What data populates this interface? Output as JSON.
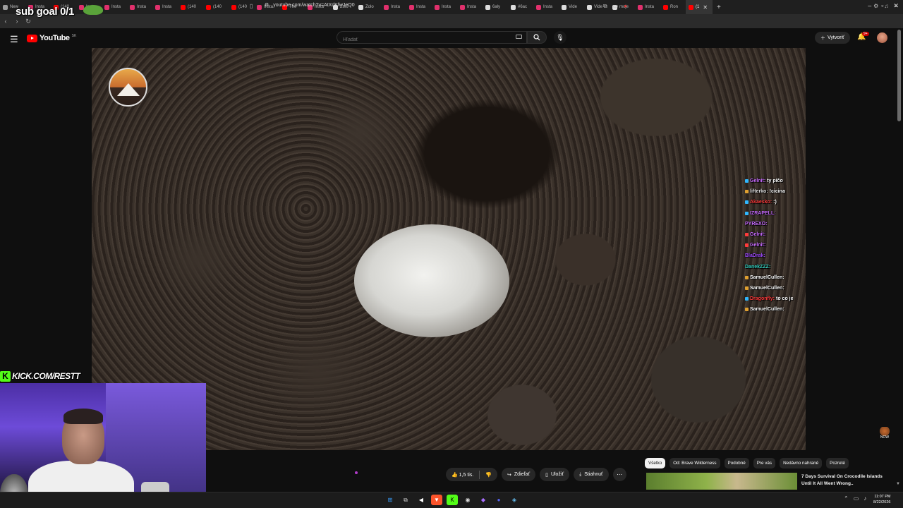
{
  "overlay": {
    "sub_goal": "sub goal 0/1",
    "kick_url": "KICK.COM/RESTT"
  },
  "browser": {
    "tabs": [
      {
        "label": "New",
        "color": "#9e9e9e"
      },
      {
        "label": "Insta",
        "color": "#e1306c"
      },
      {
        "label": "(140",
        "color": "#ff0000"
      },
      {
        "label": "Insta",
        "color": "#e1306c"
      },
      {
        "label": "Insta",
        "color": "#e1306c"
      },
      {
        "label": "Insta",
        "color": "#e1306c"
      },
      {
        "label": "Insta",
        "color": "#e1306c"
      },
      {
        "label": "(140",
        "color": "#ff0000"
      },
      {
        "label": "(140",
        "color": "#ff0000"
      },
      {
        "label": "(140",
        "color": "#ff0000"
      },
      {
        "label": "Insta",
        "color": "#e1306c"
      },
      {
        "label": "The",
        "color": "#ff0000"
      },
      {
        "label": "Insta",
        "color": "#e1306c"
      },
      {
        "label": "Zolo",
        "color": "#dddddd"
      },
      {
        "label": "Zolo",
        "color": "#dddddd"
      },
      {
        "label": "Insta",
        "color": "#e1306c"
      },
      {
        "label": "Insta",
        "color": "#e1306c"
      },
      {
        "label": "Insta",
        "color": "#e1306c"
      },
      {
        "label": "Insta",
        "color": "#e1306c"
      },
      {
        "label": "6aly",
        "color": "#dddddd"
      },
      {
        "label": "#6ac",
        "color": "#dddddd"
      },
      {
        "label": "Insta",
        "color": "#e1306c"
      },
      {
        "label": "Vide",
        "color": "#dddddd"
      },
      {
        "label": "Vide",
        "color": "#dddddd"
      },
      {
        "label": "moje",
        "color": "#dddddd"
      },
      {
        "label": "Insta",
        "color": "#e1306c"
      },
      {
        "label": "Ron",
        "color": "#ff0000"
      },
      {
        "label": "(1",
        "color": "#ff0000",
        "active": true
      }
    ],
    "url": "youtube.com/watch?v=AtXdKfwJeQ0"
  },
  "youtube": {
    "logo_text": "YouTube",
    "country_code": "SK",
    "search_placeholder": "Hľadať",
    "create_label": "Vytvoriť",
    "notification_count": "9+"
  },
  "chat": [
    {
      "user": "Gelnit:",
      "msg": "ty pičo",
      "color": "#c86bff",
      "badge": "#2fb7ff"
    },
    {
      "user": "lifterko:",
      "msg": "!cicina",
      "color": "#e0e0e0",
      "badge": "#e0a030"
    },
    {
      "user": "Akaesko:",
      "msg": ":)",
      "color": "#ff3b3b",
      "badge": "#2fb7ff"
    },
    {
      "user": "IZRAPELL:",
      "msg": "",
      "color": "#c86bff",
      "badge": "#2fb7ff"
    },
    {
      "user": "PYREXO:",
      "msg": "",
      "color": "#c86bff",
      "badge": ""
    },
    {
      "user": "Gelnit:",
      "msg": "",
      "color": "#c86bff",
      "badge": "#ff3b3b"
    },
    {
      "user": "Gelnit:",
      "msg": "",
      "color": "#c86bff",
      "badge": "#ff3b3b"
    },
    {
      "user": "BlaDrak:",
      "msg": "",
      "color": "#a04cff",
      "badge": ""
    },
    {
      "user": "DanekZZZ:",
      "msg": "",
      "color": "#30d0c0",
      "badge": ""
    },
    {
      "user": "SamuelCullen:",
      "msg": "",
      "color": "#ffffff",
      "badge": "#e0a030"
    },
    {
      "user": "SamuelCullen:",
      "msg": "",
      "color": "#ffffff",
      "badge": "#e0a030"
    },
    {
      "user": "Dragonfly:",
      "msg": "to co je",
      "color": "#ff3b3b",
      "badge": "#2fb7ff"
    },
    {
      "user": "SamuelCullen:",
      "msg": "",
      "color": "#ffffff",
      "badge": "#e0a030"
    }
  ],
  "actions": {
    "like_count": "1,5 tis.",
    "share_label": "Zdieľať",
    "save_label": "Uložiť",
    "download_label": "Stiahnuť"
  },
  "chips": [
    {
      "label": "Všetko",
      "active": true
    },
    {
      "label": "Od: Brave Wilderness"
    },
    {
      "label": "Podobné"
    },
    {
      "label": "Pre vás"
    },
    {
      "label": "Nedávno nahrané"
    },
    {
      "label": "Pozreté"
    }
  ],
  "recommended": {
    "title": "7 Days Survival On Crocodile Islands Until It All Went Wrong.."
  },
  "now_badge": "NOW",
  "taskbar": {
    "time": "11:07 PM",
    "date": "8/22/2026"
  },
  "colors": {
    "accent": "#ff0000",
    "kick": "#53fc18",
    "background": "#0f0f0f"
  }
}
